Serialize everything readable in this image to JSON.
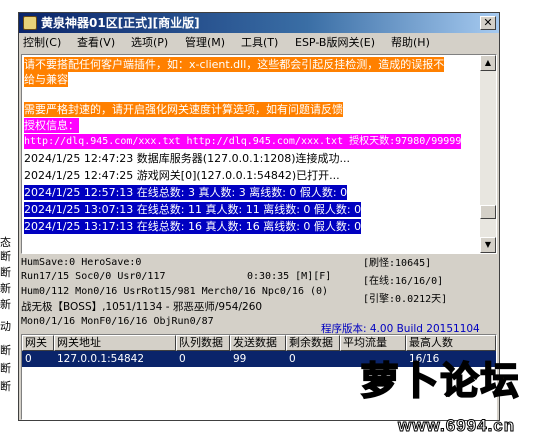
{
  "window": {
    "title": "黄泉神器01区[正式][商业版]",
    "close_glyph": "✕"
  },
  "menu": [
    {
      "label": "控制(C)"
    },
    {
      "label": "查看(V)"
    },
    {
      "label": "选项(P)"
    },
    {
      "label": "管理(M)"
    },
    {
      "label": "工具(T)"
    },
    {
      "label": "ESP-B版网关(E)"
    },
    {
      "label": "帮助(H)"
    }
  ],
  "behind_labels": [
    "态",
    "断",
    "断",
    "新",
    "新",
    "动",
    "断",
    "断",
    "断"
  ],
  "log": {
    "lines": [
      {
        "text": "请不要搭配任何客户端插件，如：x-client.dll，这些都会引起反挂检测，造成的误报不",
        "bg": "#ff8000",
        "color": "#ffffff"
      },
      {
        "text": "给与兼容",
        "bg": "#ff8000",
        "color": "#ffffff"
      },
      {
        "text": "",
        "bg": "",
        "color": "#000000"
      },
      {
        "text": "需要严格封速的，请开启强化网关速度计算选项，如有问题请反馈",
        "bg": "#ff8000",
        "color": "#ffffff"
      },
      {
        "text": "授权信息：",
        "bg": "#ff00ff",
        "color": "#ffffff"
      },
      {
        "text": "http://dlq.945.com/xxx.txt http://dlq.945.com/xxx.txt 授权天数:97980/99999",
        "bg": "#ff00ff",
        "color": "#ffffff"
      },
      {
        "text": "2024/1/25 12:47:23 数据库服务器(127.0.0.1:1208)连接成功...",
        "bg": "",
        "color": "#000000"
      },
      {
        "text": "2024/1/25 12:47:25 游戏网关[0](127.0.0.1:54842)已打开...",
        "bg": "",
        "color": "#000000"
      },
      {
        "text": "2024/1/25 12:57:13 在线总数: 3 真人数: 3 离线数: 0 假人数: 0",
        "bg": "#0000c0",
        "color": "#ffffff"
      },
      {
        "text": "2024/1/25 13:07:13 在线总数: 11 真人数: 11 离线数: 0 假人数: 0",
        "bg": "#0000c0",
        "color": "#ffffff"
      },
      {
        "text": "2024/1/25 13:17:13 在线总数: 16 真人数: 16 离线数: 0 假人数: 0",
        "bg": "#0000c0",
        "color": "#ffffff"
      }
    ],
    "scroll_up": "▲",
    "scroll_down": "▼"
  },
  "stats": {
    "line1": "HumSave:0 HeroSave:0",
    "line2": "Run17/15 Soc0/0 Usr0/117",
    "line2_time": "0:30:35 [M][F]",
    "line3": "Hum0/112 Mon0/16 UsrRot15/981 Merch0/16 Npc0/16 (0)",
    "line4": "战无极【BOSS】,1051/1134 - 邪恶巫师/954/260",
    "line5": "Mon0/1/16 MonF0/16/16 ObjRun0/87",
    "refresh": "[刷怪:10645]",
    "online": "[在线:16/16/0]",
    "ref": "[引擎:0.0212天]",
    "version": "程序版本: 4.00 Build 20151104"
  },
  "grid": {
    "headers": [
      "网关",
      "网关地址",
      "队列数据",
      "发送数据",
      "剩余数据",
      "平均流量",
      "最高人数"
    ],
    "rows": [
      [
        "0",
        "127.0.0.1:54842",
        "0",
        "99",
        "0",
        "",
        "16/16"
      ]
    ]
  },
  "watermark": {
    "logo_text": "萝卜论坛",
    "url": "www.6994.cn"
  }
}
